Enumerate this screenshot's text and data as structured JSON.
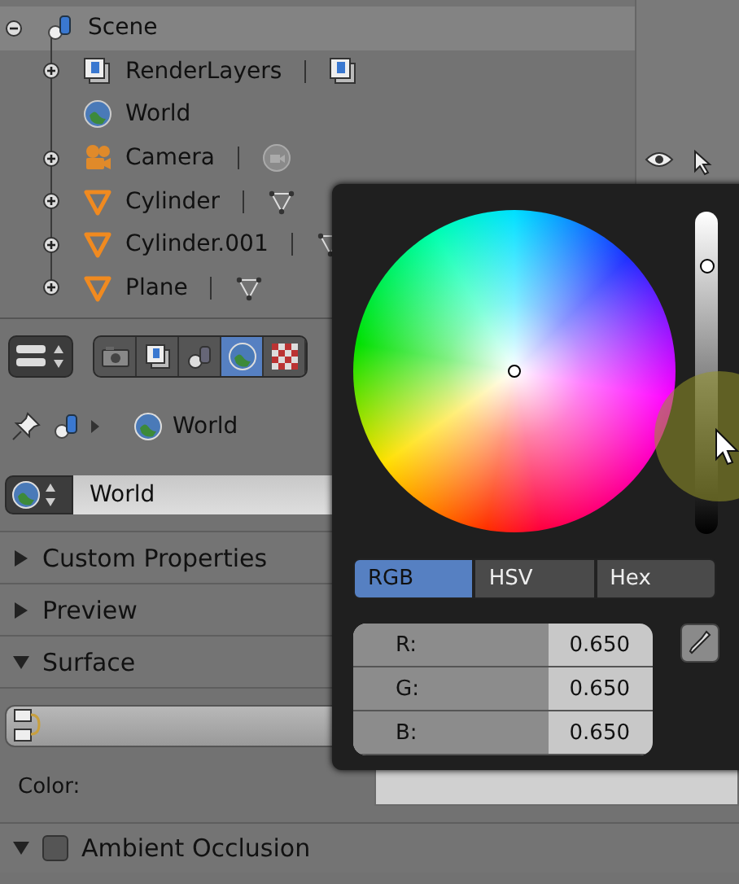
{
  "outliner": {
    "items": [
      {
        "label": "Scene",
        "kind": "scene",
        "expanded": true,
        "selected": true,
        "children": [
          {
            "label": "RenderLayers",
            "kind": "renderlayers",
            "expanded": false,
            "selected": false
          },
          {
            "label": "World",
            "kind": "world",
            "selected": false
          },
          {
            "label": "Camera",
            "kind": "camera",
            "expanded": false,
            "selected": false
          },
          {
            "label": "Cylinder",
            "kind": "mesh",
            "expanded": false,
            "selected": false
          },
          {
            "label": "Cylinder.001",
            "kind": "mesh",
            "expanded": false,
            "selected": false
          },
          {
            "label": "Plane",
            "kind": "mesh",
            "expanded": false,
            "selected": false
          }
        ]
      }
    ]
  },
  "properties": {
    "context_tabs": [
      {
        "kind": "render",
        "selected": false
      },
      {
        "kind": "renderlayers",
        "selected": false
      },
      {
        "kind": "scene",
        "selected": false
      },
      {
        "kind": "world",
        "selected": true
      },
      {
        "kind": "texture",
        "selected": false
      }
    ],
    "breadcrumb": "World",
    "datablock": "World",
    "panels": [
      {
        "title": "Custom Properties",
        "expanded": false
      },
      {
        "title": "Preview",
        "expanded": false
      },
      {
        "title": "Surface",
        "expanded": true
      }
    ],
    "color_label": "Color:",
    "ambient_occlusion": {
      "title": "Ambient Occlusion",
      "expanded": true,
      "checked": false
    }
  },
  "color_picker": {
    "value_slider": {
      "level": 0.83
    },
    "modes": [
      {
        "label": "RGB",
        "selected": true
      },
      {
        "label": "HSV",
        "selected": false
      },
      {
        "label": "Hex",
        "selected": false
      }
    ],
    "fields": [
      {
        "label": "R:",
        "value": "0.650",
        "level": 0.65
      },
      {
        "label": "G:",
        "value": "0.650",
        "level": 0.65
      },
      {
        "label": "B:",
        "value": "0.650",
        "level": 0.65
      }
    ]
  }
}
